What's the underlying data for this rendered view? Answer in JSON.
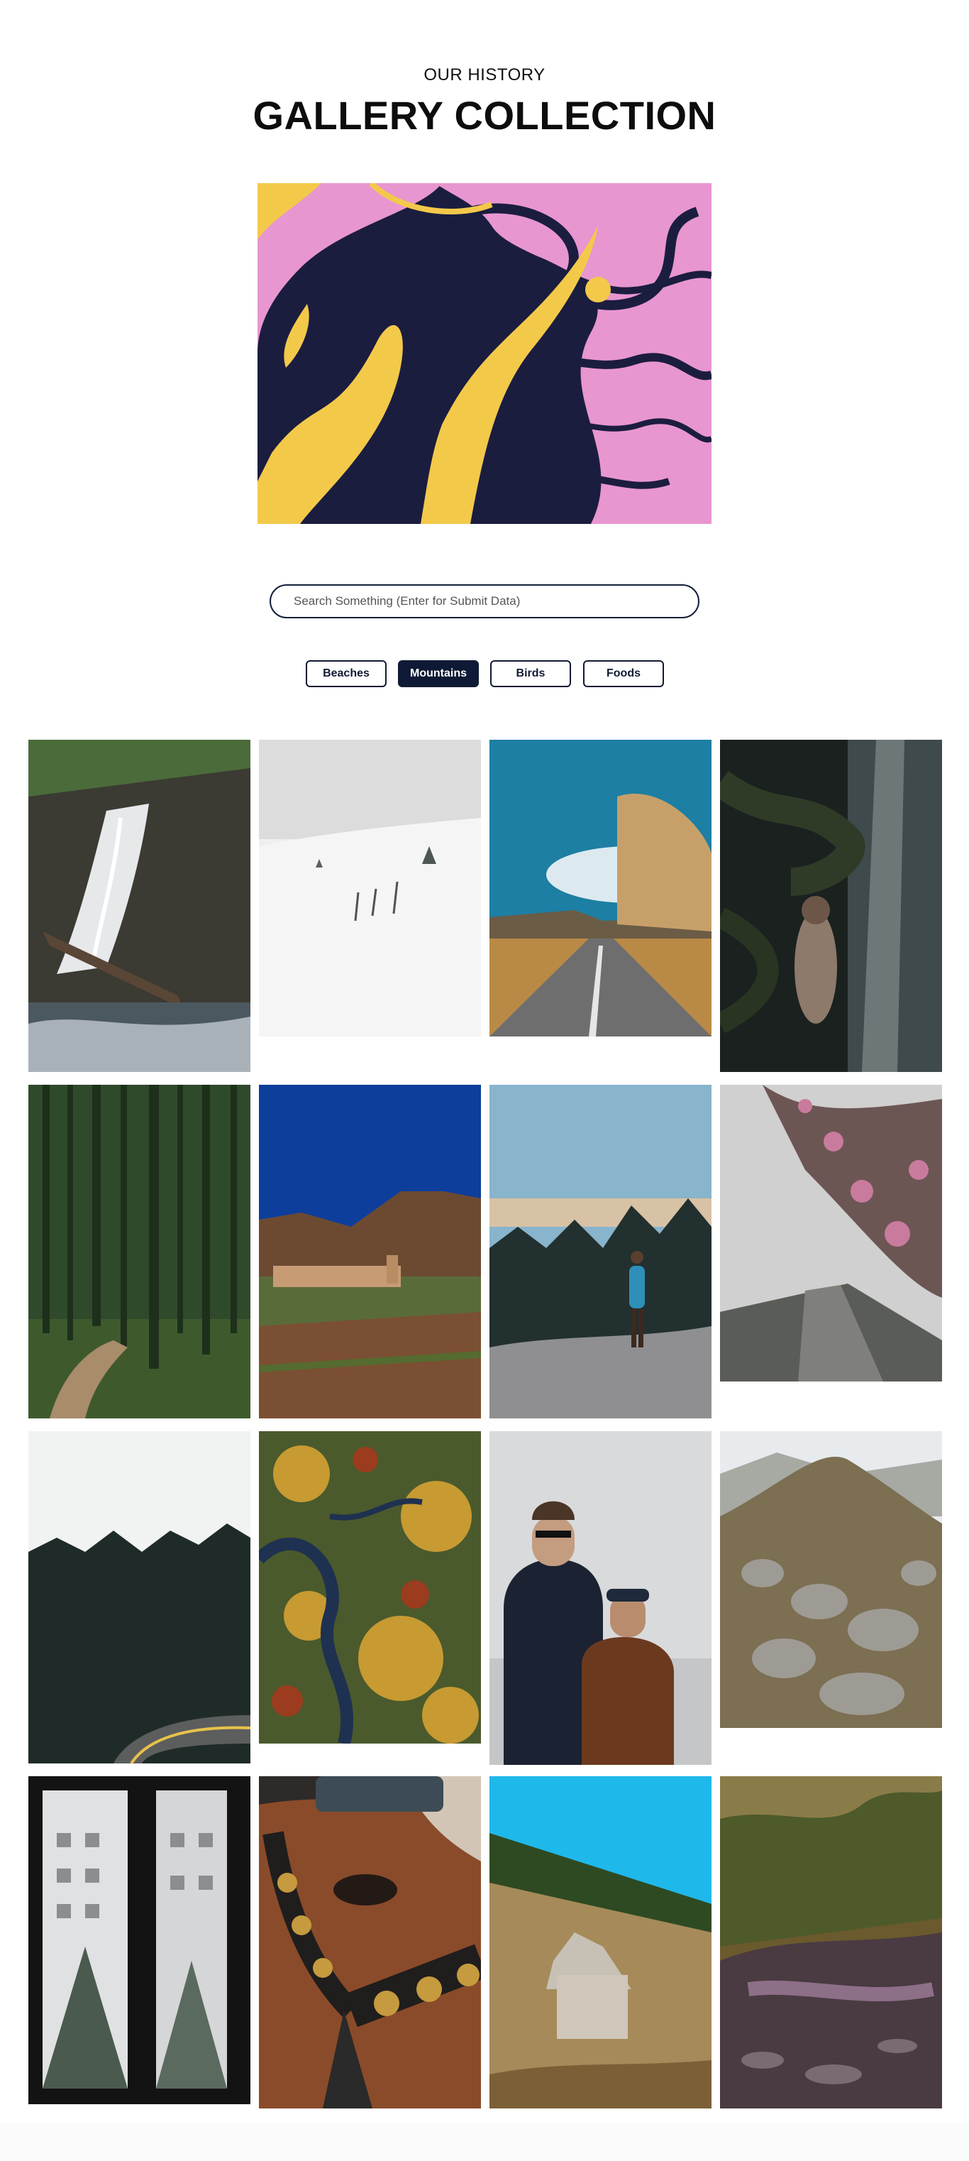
{
  "header": {
    "subtitle": "OUR HISTORY",
    "title": "GALLERY COLLECTION"
  },
  "hero": {
    "icon": "abstract-fluid-art-image",
    "colors": [
      "#1b1d3f",
      "#e896cf",
      "#f3c94a"
    ]
  },
  "search": {
    "placeholder": "Search Something (Enter for Submit Data)",
    "value": ""
  },
  "filters": [
    {
      "label": "Beaches",
      "active": false
    },
    {
      "label": "Mountains",
      "active": true
    },
    {
      "label": "Birds",
      "active": false
    },
    {
      "label": "Foods",
      "active": false
    }
  ],
  "gallery": [
    "waterfall",
    "snowy-field",
    "mountain-road",
    "forest-figure",
    "bamboo-forest",
    "mountain-village",
    "hiker-on-hill",
    "foggy-road-blossom",
    "misty-pine-road",
    "aerial-autumn-river",
    "two-men-portrait",
    "rocky-hillside",
    "snowy-window-view",
    "horse-closeup",
    "wooden-cabin-field",
    "forest-stream"
  ]
}
